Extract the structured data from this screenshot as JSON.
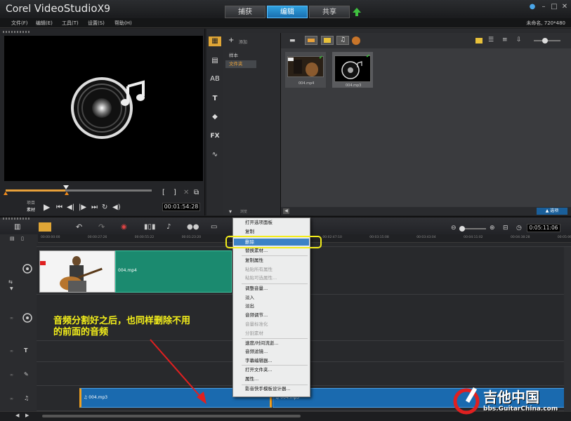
{
  "app": {
    "brand_prefix": "Corel",
    "brand_name": "VideoStudio",
    "brand_version": "X9"
  },
  "top_tabs": [
    {
      "label": "捕获"
    },
    {
      "label": "编辑"
    },
    {
      "label": "共享"
    }
  ],
  "menu": [
    {
      "label": "文件(F)"
    },
    {
      "label": "编辑(E)"
    },
    {
      "label": "工具(T)"
    },
    {
      "label": "设置(S)"
    },
    {
      "label": "帮助(H)"
    }
  ],
  "project_name": "未命名, 720*480",
  "player": {
    "project_label": "项目",
    "clip_label": "素材",
    "timecode": "00:01:54:28",
    "scrub_progress": 0.41
  },
  "library": {
    "add_label": "添加",
    "folders": [
      {
        "label": "样本"
      },
      {
        "label": "文件夹"
      }
    ],
    "browse_label": "浏览",
    "options_label": "选项",
    "items": [
      {
        "label": "004.mp4"
      },
      {
        "label": "004.mp3"
      }
    ]
  },
  "timeline": {
    "timecode": "0:05:11:06",
    "ruler": [
      {
        "label": "00:00:00:00"
      },
      {
        "label": "00:00:27:26"
      },
      {
        "label": "00:00:55:22"
      },
      {
        "label": "00:01:23:20"
      },
      {
        "label": "00:01:51:16"
      },
      {
        "label": "00:02:19:14"
      },
      {
        "label": "00:02:47:10"
      },
      {
        "label": "00:03:15:08"
      },
      {
        "label": "00:03:43:04"
      },
      {
        "label": "00:04:11:02"
      },
      {
        "label": "00:04:38:28"
      },
      {
        "label": "00:05:06:26"
      }
    ],
    "video_clip_label": "004.mp4",
    "audio_clip1_label": "004.mp3",
    "audio_clip2_label": "004.mp3"
  },
  "context_menu": {
    "items": [
      {
        "label": "打开选项面板",
        "enabled": true
      },
      {
        "label": "复制",
        "enabled": true
      },
      {
        "label": "删除",
        "enabled": true
      },
      {
        "label": "替换素材...",
        "enabled": true
      },
      {
        "label": "复制属性",
        "enabled": true
      },
      {
        "label": "粘贴所有属性",
        "enabled": false
      },
      {
        "label": "粘贴可选属性...",
        "enabled": false
      },
      {
        "label": "调整音量...",
        "enabled": true
      },
      {
        "label": "淡入",
        "enabled": true
      },
      {
        "label": "淡出",
        "enabled": true
      },
      {
        "label": "音频调节...",
        "enabled": true
      },
      {
        "label": "音量标准化",
        "enabled": false
      },
      {
        "label": "分割素材",
        "enabled": false
      },
      {
        "label": "速度/时间流逝...",
        "enabled": true
      },
      {
        "label": "音频滤镜...",
        "enabled": true
      },
      {
        "label": "字幕编辑器...",
        "enabled": true
      },
      {
        "label": "打开文件夹...",
        "enabled": true
      },
      {
        "label": "属性...",
        "enabled": true
      },
      {
        "label": "影音快手模板设计器...",
        "enabled": true
      }
    ]
  },
  "annotation": {
    "line1": "音频分割好之后，也同样删除不用",
    "line2": "的前面的音频"
  },
  "watermark": {
    "name": "吉他中国",
    "url": "bbs.GuitarChina.com"
  },
  "colors": {
    "accent": "#1f8fd8",
    "highlight_ring": "#f2ec1b",
    "annotation": "#f4ef1a",
    "arrow": "#e02020",
    "audio_clip": "#1a6aaf",
    "video_clip": "#1b8a6f"
  }
}
